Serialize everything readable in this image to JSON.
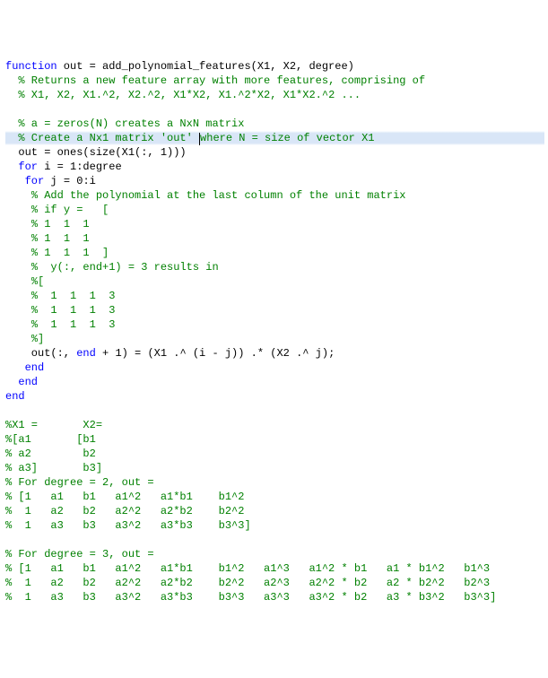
{
  "code": {
    "lines": [
      {
        "segments": [
          {
            "cls": "kw",
            "text": "function"
          },
          {
            "cls": "",
            "text": " out = add_polynomial_features(X1, X2, degree)"
          }
        ],
        "caretAfter": null,
        "highlight": false
      },
      {
        "segments": [
          {
            "cls": "",
            "text": "  "
          },
          {
            "cls": "cm",
            "text": "% Returns a new feature array with more features, comprising of"
          }
        ],
        "caretAfter": null,
        "highlight": false
      },
      {
        "segments": [
          {
            "cls": "",
            "text": "  "
          },
          {
            "cls": "cm",
            "text": "% X1, X2, X1.^2, X2.^2, X1*X2, X1.^2*X2, X1*X2.^2 ..."
          }
        ],
        "caretAfter": null,
        "highlight": false
      },
      {
        "segments": [
          {
            "cls": "",
            "text": " "
          }
        ],
        "caretAfter": null,
        "highlight": false
      },
      {
        "segments": [
          {
            "cls": "",
            "text": "  "
          },
          {
            "cls": "cm",
            "text": "% a = zeros(N) creates a NxN matrix"
          }
        ],
        "caretAfter": null,
        "highlight": false
      },
      {
        "segments": [
          {
            "cls": "",
            "text": "  "
          },
          {
            "cls": "cm",
            "text": "% Create a Nx1 matrix 'out' "
          }
        ],
        "caretAfter": 1,
        "highlight": true,
        "segmentsAfter": [
          {
            "cls": "cm",
            "text": "where N = size of vector X1"
          }
        ]
      },
      {
        "segments": [
          {
            "cls": "",
            "text": "  out = ones(size(X1(:, "
          },
          {
            "cls": "nm",
            "text": "1"
          },
          {
            "cls": "",
            "text": ")))"
          }
        ],
        "caretAfter": null,
        "highlight": false
      },
      {
        "segments": [
          {
            "cls": "",
            "text": "  "
          },
          {
            "cls": "kw",
            "text": "for"
          },
          {
            "cls": "",
            "text": " i = "
          },
          {
            "cls": "nm",
            "text": "1"
          },
          {
            "cls": "",
            "text": ":degree"
          }
        ],
        "caretAfter": null,
        "highlight": false
      },
      {
        "segments": [
          {
            "cls": "",
            "text": "   "
          },
          {
            "cls": "kw",
            "text": "for"
          },
          {
            "cls": "",
            "text": " j = "
          },
          {
            "cls": "nm",
            "text": "0"
          },
          {
            "cls": "",
            "text": ":i"
          }
        ],
        "caretAfter": null,
        "highlight": false
      },
      {
        "segments": [
          {
            "cls": "",
            "text": "    "
          },
          {
            "cls": "cm",
            "text": "% Add the polynomial at the last column of the unit matrix"
          }
        ],
        "caretAfter": null,
        "highlight": false
      },
      {
        "segments": [
          {
            "cls": "",
            "text": "    "
          },
          {
            "cls": "cm",
            "text": "% if y =   ["
          }
        ],
        "caretAfter": null,
        "highlight": false
      },
      {
        "segments": [
          {
            "cls": "",
            "text": "    "
          },
          {
            "cls": "cm",
            "text": "% 1  1  1"
          }
        ],
        "caretAfter": null,
        "highlight": false
      },
      {
        "segments": [
          {
            "cls": "",
            "text": "    "
          },
          {
            "cls": "cm",
            "text": "% 1  1  1"
          }
        ],
        "caretAfter": null,
        "highlight": false
      },
      {
        "segments": [
          {
            "cls": "",
            "text": "    "
          },
          {
            "cls": "cm",
            "text": "% 1  1  1  ]"
          }
        ],
        "caretAfter": null,
        "highlight": false
      },
      {
        "segments": [
          {
            "cls": "",
            "text": "    "
          },
          {
            "cls": "cm",
            "text": "%  y(:, end+1) = 3 results in"
          }
        ],
        "caretAfter": null,
        "highlight": false
      },
      {
        "segments": [
          {
            "cls": "",
            "text": "    "
          },
          {
            "cls": "cm",
            "text": "%["
          }
        ],
        "caretAfter": null,
        "highlight": false
      },
      {
        "segments": [
          {
            "cls": "",
            "text": "    "
          },
          {
            "cls": "cm",
            "text": "%  1  1  1  3"
          }
        ],
        "caretAfter": null,
        "highlight": false
      },
      {
        "segments": [
          {
            "cls": "",
            "text": "    "
          },
          {
            "cls": "cm",
            "text": "%  1  1  1  3"
          }
        ],
        "caretAfter": null,
        "highlight": false
      },
      {
        "segments": [
          {
            "cls": "",
            "text": "    "
          },
          {
            "cls": "cm",
            "text": "%  1  1  1  3"
          }
        ],
        "caretAfter": null,
        "highlight": false
      },
      {
        "segments": [
          {
            "cls": "",
            "text": "    "
          },
          {
            "cls": "cm",
            "text": "%]"
          }
        ],
        "caretAfter": null,
        "highlight": false
      },
      {
        "segments": [
          {
            "cls": "",
            "text": "    out(:, "
          },
          {
            "cls": "kw",
            "text": "end"
          },
          {
            "cls": "",
            "text": " + "
          },
          {
            "cls": "nm",
            "text": "1"
          },
          {
            "cls": "",
            "text": ") = (X1 .^ (i - j)) .* (X2 .^ j);"
          }
        ],
        "caretAfter": null,
        "highlight": false
      },
      {
        "segments": [
          {
            "cls": "",
            "text": "   "
          },
          {
            "cls": "kw",
            "text": "end"
          }
        ],
        "caretAfter": null,
        "highlight": false
      },
      {
        "segments": [
          {
            "cls": "",
            "text": "  "
          },
          {
            "cls": "kw",
            "text": "end"
          }
        ],
        "caretAfter": null,
        "highlight": false
      },
      {
        "segments": [
          {
            "cls": "kw",
            "text": "end"
          }
        ],
        "caretAfter": null,
        "highlight": false
      },
      {
        "segments": [
          {
            "cls": "",
            "text": " "
          }
        ],
        "caretAfter": null,
        "highlight": false
      },
      {
        "segments": [
          {
            "cls": "cm",
            "text": "%X1 =       X2="
          }
        ],
        "caretAfter": null,
        "highlight": false
      },
      {
        "segments": [
          {
            "cls": "cm",
            "text": "%[a1       [b1"
          }
        ],
        "caretAfter": null,
        "highlight": false
      },
      {
        "segments": [
          {
            "cls": "cm",
            "text": "% a2        b2"
          }
        ],
        "caretAfter": null,
        "highlight": false
      },
      {
        "segments": [
          {
            "cls": "cm",
            "text": "% a3]       b3]"
          }
        ],
        "caretAfter": null,
        "highlight": false
      },
      {
        "segments": [
          {
            "cls": "cm",
            "text": "% For degree = 2, out ="
          }
        ],
        "caretAfter": null,
        "highlight": false
      },
      {
        "segments": [
          {
            "cls": "cm",
            "text": "% [1   a1   b1   a1^2   a1*b1    b1^2"
          }
        ],
        "caretAfter": null,
        "highlight": false
      },
      {
        "segments": [
          {
            "cls": "cm",
            "text": "%  1   a2   b2   a2^2   a2*b2    b2^2"
          }
        ],
        "caretAfter": null,
        "highlight": false
      },
      {
        "segments": [
          {
            "cls": "cm",
            "text": "%  1   a3   b3   a3^2   a3*b3    b3^3]"
          }
        ],
        "caretAfter": null,
        "highlight": false
      },
      {
        "segments": [
          {
            "cls": "",
            "text": " "
          }
        ],
        "caretAfter": null,
        "highlight": false
      },
      {
        "segments": [
          {
            "cls": "cm",
            "text": "% For degree = 3, out ="
          }
        ],
        "caretAfter": null,
        "highlight": false
      },
      {
        "segments": [
          {
            "cls": "cm",
            "text": "% [1   a1   b1   a1^2   a1*b1    b1^2   a1^3   a1^2 * b1   a1 * b1^2   b1^3"
          }
        ],
        "caretAfter": null,
        "highlight": false
      },
      {
        "segments": [
          {
            "cls": "cm",
            "text": "%  1   a2   b2   a2^2   a2*b2    b2^2   a2^3   a2^2 * b2   a2 * b2^2   b2^3"
          }
        ],
        "caretAfter": null,
        "highlight": false
      },
      {
        "segments": [
          {
            "cls": "cm",
            "text": "%  1   a3   b3   a3^2   a3*b3    b3^3   a3^3   a3^2 * b2   a3 * b3^2   b3^3]"
          }
        ],
        "caretAfter": null,
        "highlight": false
      }
    ]
  }
}
